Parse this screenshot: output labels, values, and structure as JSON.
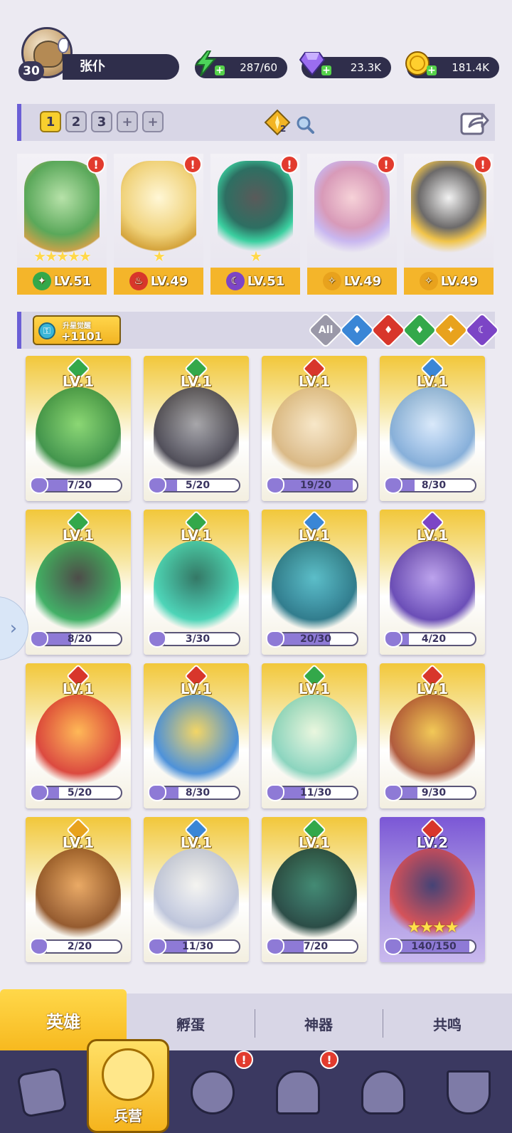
{
  "player": {
    "level": "30",
    "name": "张仆"
  },
  "resources": {
    "energy": "287/60",
    "gems": "23.3K",
    "gold": "181.4K"
  },
  "team_tabs": [
    "1",
    "2",
    "3",
    "+",
    "+"
  ],
  "team_counter": "2",
  "team": [
    {
      "element": "nature",
      "level": "LV.51",
      "stars": "★★★★★",
      "alert": "!"
    },
    {
      "element": "fire",
      "level": "LV.49",
      "stars": "★",
      "alert": "!"
    },
    {
      "element": "dark",
      "level": "LV.51",
      "stars": "★",
      "alert": "!"
    },
    {
      "element": "light",
      "level": "LV.49",
      "stars": "",
      "alert": "!"
    },
    {
      "element": "light",
      "level": "LV.49",
      "stars": "",
      "alert": "!"
    }
  ],
  "awaken": {
    "label": "升星觉醒",
    "value": "+1101"
  },
  "filters": [
    {
      "label": "All",
      "color": "#9a98a8"
    },
    {
      "label": "",
      "color": "#3a86d6"
    },
    {
      "label": "",
      "color": "#d8362b"
    },
    {
      "label": "",
      "color": "#33a84a"
    },
    {
      "label": "",
      "color": "#e8a21d"
    },
    {
      "label": "",
      "color": "#7c45c6"
    }
  ],
  "heroes": [
    {
      "level": "LV.1",
      "shards": "7/20",
      "progress": 0.35,
      "element": "nature"
    },
    {
      "level": "LV.1",
      "shards": "5/20",
      "progress": 0.25,
      "element": "nature"
    },
    {
      "level": "LV.1",
      "shards": "19/20",
      "progress": 0.95,
      "element": "fire"
    },
    {
      "level": "LV.1",
      "shards": "8/30",
      "progress": 0.27,
      "element": "water"
    },
    {
      "level": "LV.1",
      "shards": "8/20",
      "progress": 0.4,
      "element": "nature"
    },
    {
      "level": "LV.1",
      "shards": "3/30",
      "progress": 0.1,
      "element": "nature"
    },
    {
      "level": "LV.1",
      "shards": "20/30",
      "progress": 0.67,
      "element": "water"
    },
    {
      "level": "LV.1",
      "shards": "4/20",
      "progress": 0.2,
      "element": "dark"
    },
    {
      "level": "LV.1",
      "shards": "5/20",
      "progress": 0.25,
      "element": "fire"
    },
    {
      "level": "LV.1",
      "shards": "8/30",
      "progress": 0.27,
      "element": "fire"
    },
    {
      "level": "LV.1",
      "shards": "11/30",
      "progress": 0.37,
      "element": "nature"
    },
    {
      "level": "LV.1",
      "shards": "9/30",
      "progress": 0.3,
      "element": "fire"
    },
    {
      "level": "LV.1",
      "shards": "2/20",
      "progress": 0.1,
      "element": "light"
    },
    {
      "level": "LV.1",
      "shards": "11/30",
      "progress": 0.37,
      "element": "water"
    },
    {
      "level": "LV.1",
      "shards": "7/20",
      "progress": 0.35,
      "element": "nature"
    },
    {
      "level": "LV.2",
      "shards": "140/150",
      "progress": 0.93,
      "element": "fire",
      "stars": "★★★★",
      "rare": true
    }
  ],
  "sub_tabs": [
    "英雄",
    "孵蛋",
    "神器",
    "共鸣"
  ],
  "bottom_nav": {
    "active_label": "兵营",
    "alerts": [
      "!",
      "!"
    ]
  },
  "colors": {
    "nature": "#33a84a",
    "fire": "#d8362b",
    "water": "#3a86d6",
    "dark": "#7c45c6",
    "light": "#e8a21d",
    "accent": "#6b5fd6",
    "navbar": "#3b3961"
  }
}
